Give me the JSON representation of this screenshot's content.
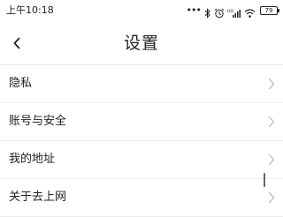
{
  "status_bar": {
    "time": "上午10:18",
    "dots": "•••",
    "icons": [
      "bluetooth-icon",
      "alarm-icon",
      "hd-signal-icon",
      "wifi-icon",
      "battery-icon"
    ],
    "battery_level": "79"
  },
  "header": {
    "title": "设置",
    "back_icon": "chevron-left-icon"
  },
  "settings": {
    "items": [
      {
        "label": "隐私"
      },
      {
        "label": "账号与安全"
      },
      {
        "label": "我的地址"
      },
      {
        "label": "关于去上网"
      }
    ]
  },
  "colors": {
    "text": "#222222",
    "divider": "#ededed",
    "chevron": "#b5b5b5",
    "background": "#ffffff"
  }
}
